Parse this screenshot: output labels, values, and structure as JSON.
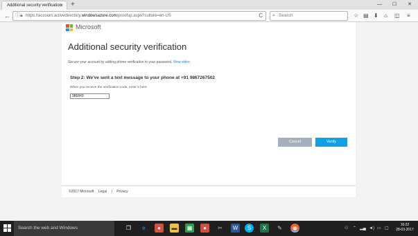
{
  "browser": {
    "tab_title": "Additional security verification",
    "tab_close": "×",
    "new_tab": "+",
    "window_controls": {
      "minimize": "—",
      "maximize": "☐",
      "close": "✕"
    },
    "url_prefix": "https://account.activedirectory.",
    "url_host": "windowsazure.com",
    "url_path": "/proofup.aspx?culture=en-US",
    "search_placeholder": "Search",
    "nav": {
      "back": "←",
      "info": "ⓘ",
      "lock": "🔒",
      "reload": "C"
    }
  },
  "page": {
    "brand": "Microsoft",
    "brand_colors": {
      "red": "#f25022",
      "green": "#7fba00",
      "blue": "#00a4ef",
      "yellow": "#ffb900"
    },
    "title": "Additional security verification",
    "subtitle": "Secure your account by adding phone verification to your password.",
    "view_video": "View video",
    "step": "Step 2: We've sent a text message to your phone at +91 9867267502",
    "hint": "When you receive the verification code, enter it here",
    "code_value": "986843",
    "cancel_label": "Cancel",
    "verify_label": "Verify",
    "footer": {
      "copyright": "©2017 Microsoft",
      "legal": "Legal",
      "separator": "|",
      "privacy": "Privacy"
    }
  },
  "taskbar": {
    "search_placeholder": "Search the web and Windows",
    "time": "16:22",
    "date": "28-03-2017"
  }
}
